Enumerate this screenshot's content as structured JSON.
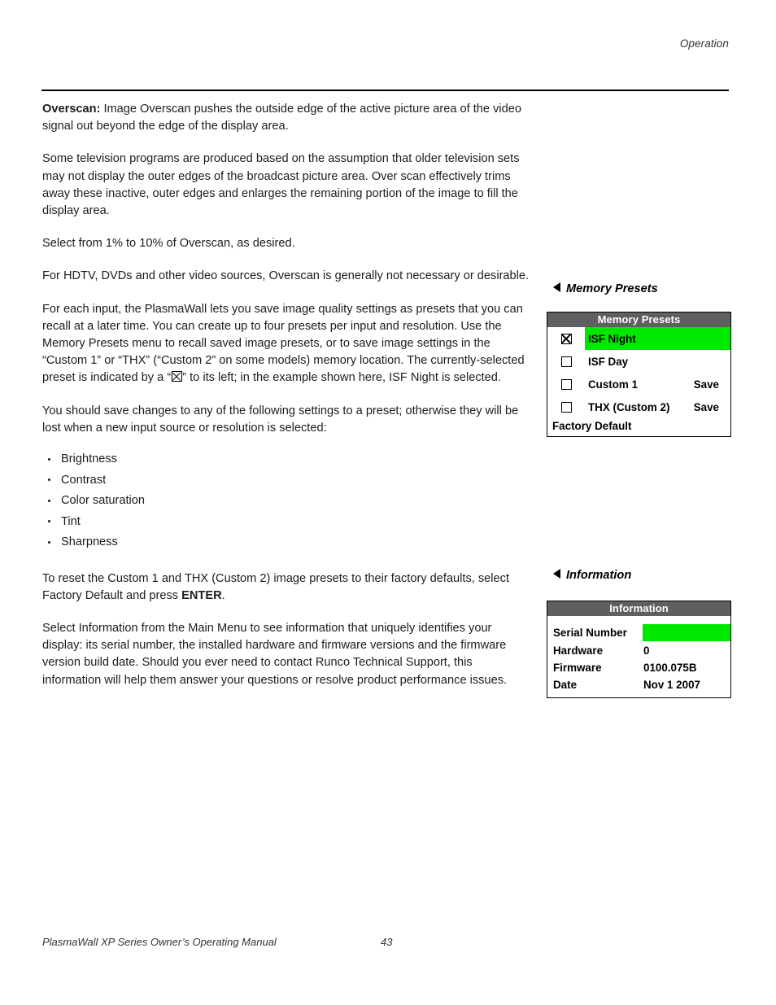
{
  "running_head": "Operation",
  "body": {
    "p1_lead": "Overscan:",
    "p1_rest": " Image Overscan pushes the outside edge of the active picture area of the video signal out beyond the edge of the display area.",
    "p2": "Some television programs are produced based on the assumption that older television sets may not display the outer edges of the broadcast picture area. Over scan effectively trims away these inactive, outer edges and enlarges the remaining portion of the image to fill the display area.",
    "p3": "Select from 1% to 10% of Overscan, as desired.",
    "p4": "For HDTV, DVDs and other video sources, Overscan is generally not necessary or desirable.",
    "p5_a": "For each input, the PlasmaWall lets you save image quality settings as presets that you can recall at a later time. You can create up to four presets per input and resolution. Use the Memory Presets menu to recall saved image presets, or to save image settings in the “Custom 1” or “THX” (“Custom 2” on some models) memory location. The currently-selected preset is indicated by a “",
    "p5_b": "” to its left; in the example shown here, ISF Night is selected.",
    "p6": "You should save changes to any of the following settings to a preset; otherwise they will be lost when a new input source or resolution is selected:",
    "bullets": [
      "Brightness",
      "Contrast",
      "Color saturation",
      "Tint",
      "Sharpness"
    ],
    "p7_a": "To reset the Custom 1 and THX (Custom 2) image presets to their factory defaults, select Factory Default and press ",
    "p7_bold": "ENTER",
    "p7_b": ".",
    "p8": "Select Information from the Main Menu to see information that uniquely identifies your display: its serial number, the installed hardware and firmware versions and the firmware version build date. Should you ever need to contact Runco Technical Support, this information will help them answer your questions or resolve product performance issues."
  },
  "callouts": {
    "memory_presets": "Memory Presets",
    "information": "Information"
  },
  "memory_presets_panel": {
    "title": "Memory Presets",
    "rows": [
      {
        "label": "ISF Night",
        "checked": true,
        "selected": true,
        "action": ""
      },
      {
        "label": "ISF Day",
        "checked": false,
        "selected": false,
        "action": ""
      },
      {
        "label": "Custom 1",
        "checked": false,
        "selected": false,
        "action": "Save"
      },
      {
        "label": "THX (Custom 2)",
        "checked": false,
        "selected": false,
        "action": "Save"
      }
    ],
    "footer": "Factory Default",
    "highlight_color": "#00e800",
    "title_bar_color": "#5f5f5f"
  },
  "information_panel": {
    "title": "Information",
    "rows": [
      {
        "key": "Serial Number",
        "value": "",
        "redacted": true
      },
      {
        "key": "Hardware",
        "value": "0",
        "redacted": false
      },
      {
        "key": "Firmware",
        "value": "0100.075B",
        "redacted": false
      },
      {
        "key": "Date",
        "value": "Nov 1 2007",
        "redacted": false
      }
    ],
    "redaction_color": "#00e800",
    "title_bar_color": "#5f5f5f"
  },
  "footer": {
    "manual_title": "PlasmaWall XP Series Owner’s Operating Manual",
    "page_number": "43"
  }
}
